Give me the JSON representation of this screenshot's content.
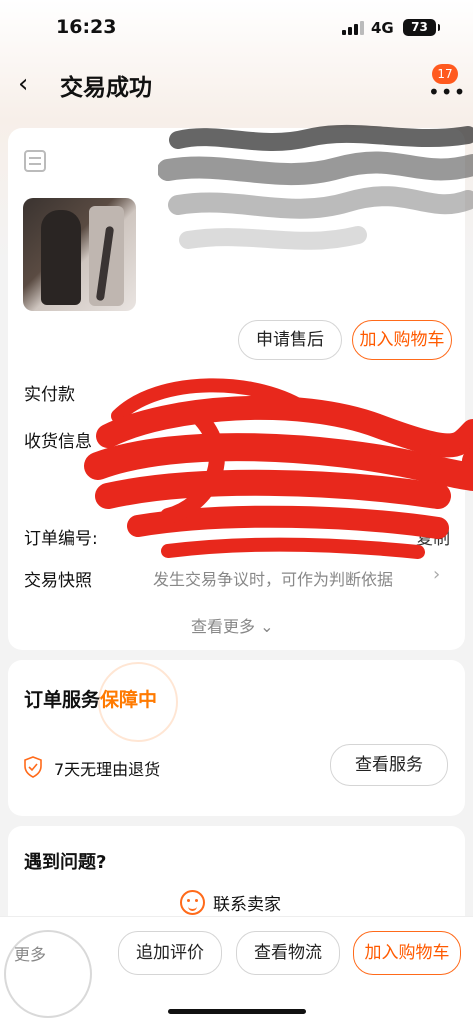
{
  "status_bar": {
    "time": "16:23",
    "network": "4G",
    "battery": "73"
  },
  "nav": {
    "back_icon": "chevron-left-icon",
    "title": "交易成功",
    "badge_count": "17"
  },
  "order_card": {
    "after_sale_label": "申请售后",
    "add_cart_label": "加入购物车",
    "paid_label": "实付款",
    "address_label": "收货信息",
    "order_no_label": "订单编号:",
    "copy_label": "复制",
    "snapshot_label": "交易快照",
    "snapshot_desc": "发生交易争议时，可作为判断依据",
    "see_more_label": "查看更多"
  },
  "service_card": {
    "title": "订单服务",
    "status": "保障中",
    "item": "7天无理由退货",
    "view_button": "查看服务"
  },
  "problem_card": {
    "title": "遇到问题?",
    "contact_label": "联系卖家"
  },
  "bottom_bar": {
    "more_label": "更多",
    "review_label": "追加评价",
    "logistics_label": "查看物流",
    "add_cart_label": "加入购物车"
  },
  "colors": {
    "accent": "#ff5a00",
    "badge": "#ff5a1f",
    "redaction": "#e8281c"
  }
}
